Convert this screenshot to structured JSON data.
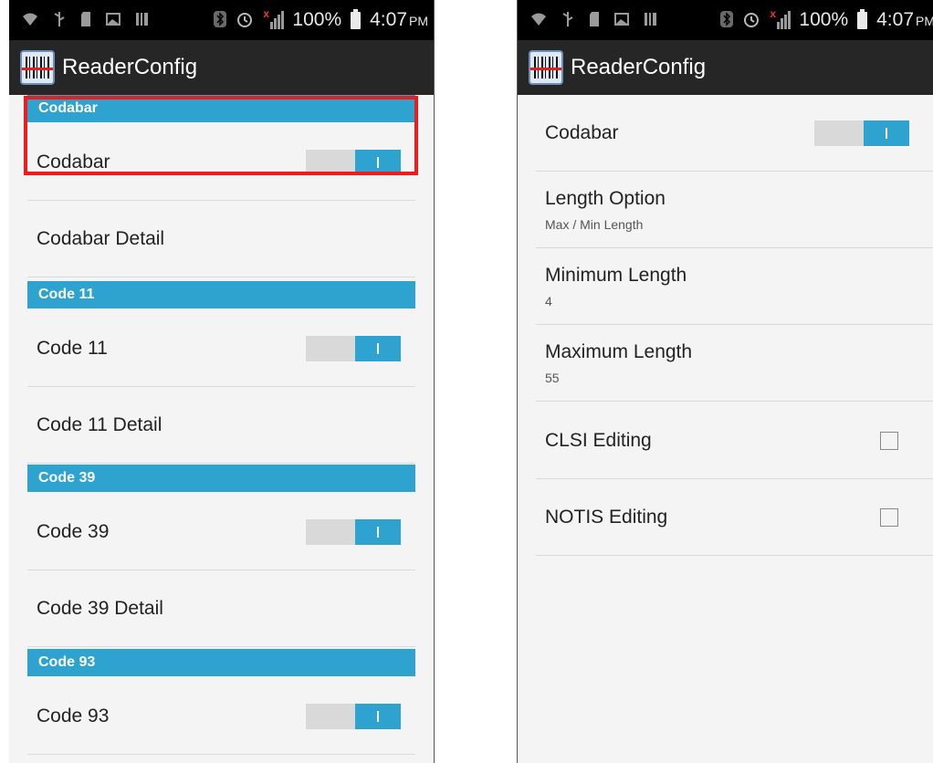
{
  "status_bar": {
    "battery_percent": "100%",
    "time": "4:07",
    "ampm": "PM",
    "left_icons": [
      "wifi-icon",
      "usb-icon",
      "sim-icon",
      "image-icon",
      "barcode-icon"
    ],
    "right_icons": [
      "bluetooth-icon",
      "alarm-icon",
      "signal-icon",
      "battery-icon"
    ]
  },
  "app_bar": {
    "title": "ReaderConfig"
  },
  "left_screen": {
    "sections": [
      {
        "header": "Codabar",
        "toggle_label": "Codabar",
        "toggle_on": true,
        "detail_label": "Codabar Detail"
      },
      {
        "header": "Code 11",
        "toggle_label": "Code 11",
        "toggle_on": true,
        "detail_label": "Code 11 Detail"
      },
      {
        "header": "Code 39",
        "toggle_label": "Code 39",
        "toggle_on": true,
        "detail_label": "Code 39 Detail"
      },
      {
        "header": "Code 93",
        "toggle_label": "Code 93",
        "toggle_on": true
      }
    ],
    "highlight_color": "#ee1c1c"
  },
  "right_screen": {
    "codabar": {
      "label": "Codabar",
      "toggle_on": true
    },
    "length_option": {
      "title": "Length Option",
      "summary": "Max / Min Length"
    },
    "minimum_length": {
      "title": "Minimum Length",
      "value": "4"
    },
    "maximum_length": {
      "title": "Maximum Length",
      "value": "55"
    },
    "clsi_editing": {
      "label": "CLSI Editing",
      "checked": false
    },
    "notis_editing": {
      "label": "NOTIS Editing",
      "checked": false
    }
  },
  "colors": {
    "accent": "#2ea3cf",
    "app_bar": "#262626",
    "status_bar": "#000000",
    "background": "#f4f4f4"
  }
}
